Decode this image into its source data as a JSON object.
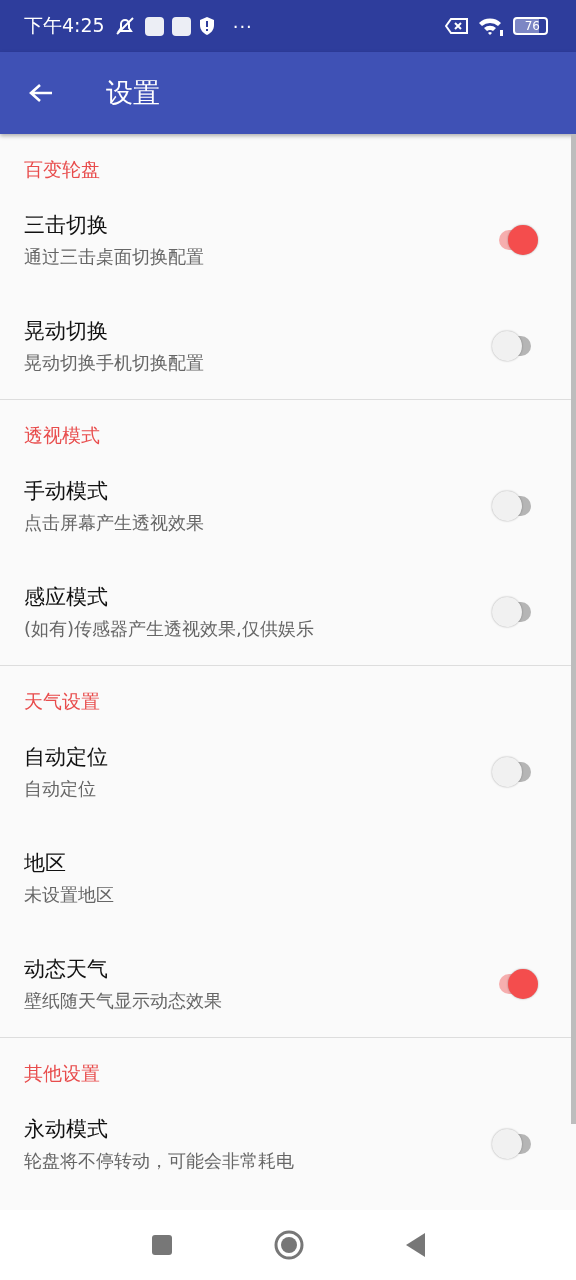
{
  "status_bar": {
    "time": "下午4:25",
    "more": "···",
    "battery": "76"
  },
  "app_bar": {
    "title": "设置"
  },
  "sections": [
    {
      "title": "百变轮盘",
      "items": [
        {
          "title": "三击切换",
          "subtitle": "通过三击桌面切换配置",
          "kind": "switch",
          "on": true
        },
        {
          "title": "晃动切换",
          "subtitle": "晃动切换手机切换配置",
          "kind": "switch",
          "on": false
        }
      ]
    },
    {
      "title": "透视模式",
      "items": [
        {
          "title": "手动模式",
          "subtitle": "点击屏幕产生透视效果",
          "kind": "switch",
          "on": false
        },
        {
          "title": "感应模式",
          "subtitle": "(如有)传感器产生透视效果,仅供娱乐",
          "kind": "switch",
          "on": false
        }
      ]
    },
    {
      "title": "天气设置",
      "items": [
        {
          "title": "自动定位",
          "subtitle": "自动定位",
          "kind": "switch",
          "on": false
        },
        {
          "title": "地区",
          "subtitle": "未设置地区",
          "kind": "plain"
        },
        {
          "title": "动态天气",
          "subtitle": "壁纸随天气显示动态效果",
          "kind": "switch",
          "on": true
        }
      ]
    },
    {
      "title": "其他设置",
      "items": [
        {
          "title": "永动模式",
          "subtitle": "轮盘将不停转动，可能会非常耗电",
          "kind": "switch",
          "on": false
        }
      ]
    }
  ]
}
